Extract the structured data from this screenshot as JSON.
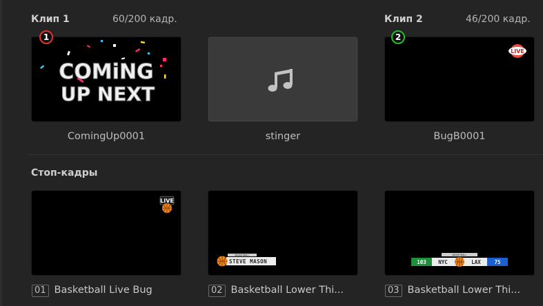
{
  "clip1": {
    "title": "Клип 1",
    "frames": "60/200 кадр.",
    "badge": "1",
    "name": "ComingUp0001",
    "art_line1": "COMiNG",
    "art_line2": "UP NEXT"
  },
  "stinger": {
    "name": "stinger",
    "icon": "music-note-icon"
  },
  "clip2": {
    "title": "Клип 2",
    "frames": "46/200 кадр.",
    "badge": "2",
    "name": "BugB0001",
    "live_text": "LIVE"
  },
  "stills": {
    "title": "Стоп-кадры",
    "items": [
      {
        "num": "01",
        "label": "Basketball Live Bug",
        "art_text": "LIVE"
      },
      {
        "num": "02",
        "label": "Basketball Lower Thi...",
        "art_text": "STEVE MASON",
        "art_small": "BASKETBALL"
      },
      {
        "num": "03",
        "label": "Basketball Lower Thi...",
        "score_home": "103",
        "team_home": "NYC",
        "team_away": "LAX",
        "score_away": "75",
        "art_small": "BASKETBALL"
      }
    ]
  },
  "colors": {
    "badge1": "#e5312e",
    "badge2": "#1fbf2c",
    "score_home_bg": "#1e8f3a",
    "score_away_bg": "#1b5fd1"
  }
}
